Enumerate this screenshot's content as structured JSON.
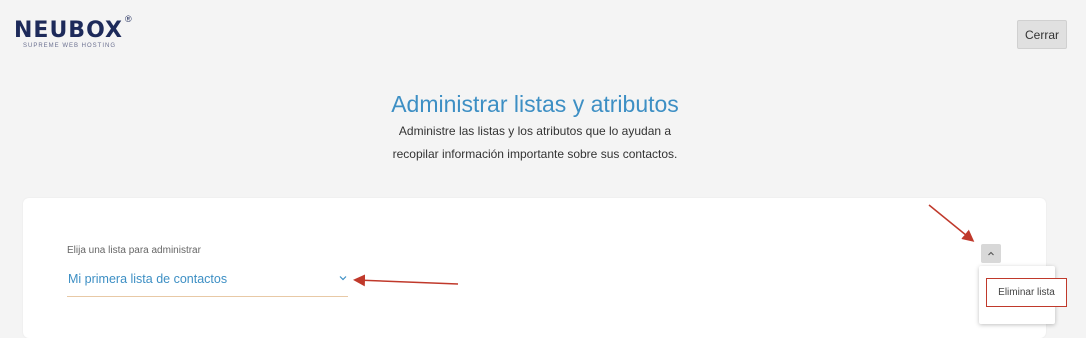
{
  "header": {
    "logo_text": "NEUBOX",
    "logo_registered": "®",
    "logo_tagline": "SUPREME WEB HOSTING",
    "close_label": "Cerrar"
  },
  "page": {
    "title": "Administrar listas y atributos",
    "description_line1": "Administre las listas y los atributos que lo ayudan a",
    "description_line2": "recopilar información importante sobre sus contactos."
  },
  "list_selector": {
    "label": "Elija una lista para administrar",
    "selected_value": "Mi primera lista de contactos"
  },
  "actions_menu": {
    "items": [
      "Eliminar lista"
    ]
  },
  "colors": {
    "accent_blue": "#3d8fc4",
    "annotation_red": "#c0392b",
    "brand_navy": "#1d2a5a"
  }
}
